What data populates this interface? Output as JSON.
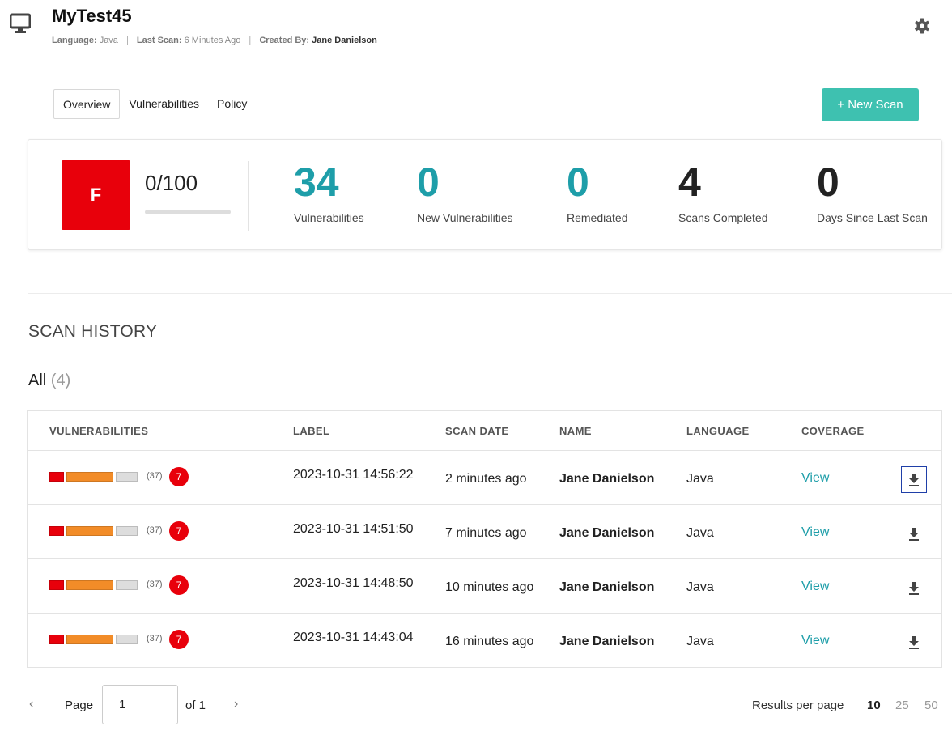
{
  "header": {
    "title": "MyTest45",
    "language_key": "Language:",
    "language_value": "Java",
    "last_scan_key": "Last Scan:",
    "last_scan_value": "6 Minutes Ago",
    "created_by_key": "Created By:",
    "created_by_value": "Jane Danielson",
    "separator": "|"
  },
  "tabs": [
    {
      "label": "Overview",
      "active": true
    },
    {
      "label": "Vulnerabilities",
      "active": false
    },
    {
      "label": "Policy",
      "active": false
    }
  ],
  "actions": {
    "new_scan": "+ New Scan"
  },
  "summary": {
    "grade": "F",
    "score": "0/100",
    "score_fraction": 0,
    "stats": [
      {
        "value": "34",
        "label": "Vulnerabilities"
      },
      {
        "value": "0",
        "label": "New Vulnerabilities"
      },
      {
        "value": "0",
        "label": "Remediated"
      },
      {
        "value": "4",
        "label": "Scans Completed"
      },
      {
        "value": "0",
        "label": "Days Since Last Scan"
      }
    ]
  },
  "scan_history": {
    "title": "SCAN HISTORY",
    "filter_label": "All",
    "filter_count": "(4)",
    "columns": [
      "VULNERABILITIES",
      "LABEL",
      "SCAN DATE",
      "NAME",
      "LANGUAGE",
      "COVERAGE"
    ],
    "rows": [
      {
        "count": "(37)",
        "badge": "7",
        "label": "2023-10-31 14:56:22",
        "scan_date": "2 minutes ago",
        "name": "Jane Danielson",
        "language": "Java",
        "coverage": "View"
      },
      {
        "count": "(37)",
        "badge": "7",
        "label": "2023-10-31 14:51:50",
        "scan_date": "7 minutes ago",
        "name": "Jane Danielson",
        "language": "Java",
        "coverage": "View"
      },
      {
        "count": "(37)",
        "badge": "7",
        "label": "2023-10-31 14:48:50",
        "scan_date": "10 minutes ago",
        "name": "Jane Danielson",
        "language": "Java",
        "coverage": "View"
      },
      {
        "count": "(37)",
        "badge": "7",
        "label": "2023-10-31 14:43:04",
        "scan_date": "16 minutes ago",
        "name": "Jane Danielson",
        "language": "Java",
        "coverage": "View"
      }
    ]
  },
  "pagination": {
    "prev": "‹",
    "page_label": "Page",
    "page_value": "1",
    "of_label": "of 1",
    "next": "›",
    "results_per_page_label": "Results per page",
    "options": [
      "10",
      "25",
      "50"
    ],
    "selected": "10"
  },
  "icons": {
    "monitor": "monitor-icon",
    "settings": "gear-icon",
    "download": "download-icon"
  },
  "colors": {
    "accent": "#3ec1b0",
    "stat_teal": "#1e9ea9",
    "critical": "#e8000b",
    "high": "#f28c28",
    "low": "#dddddd"
  }
}
